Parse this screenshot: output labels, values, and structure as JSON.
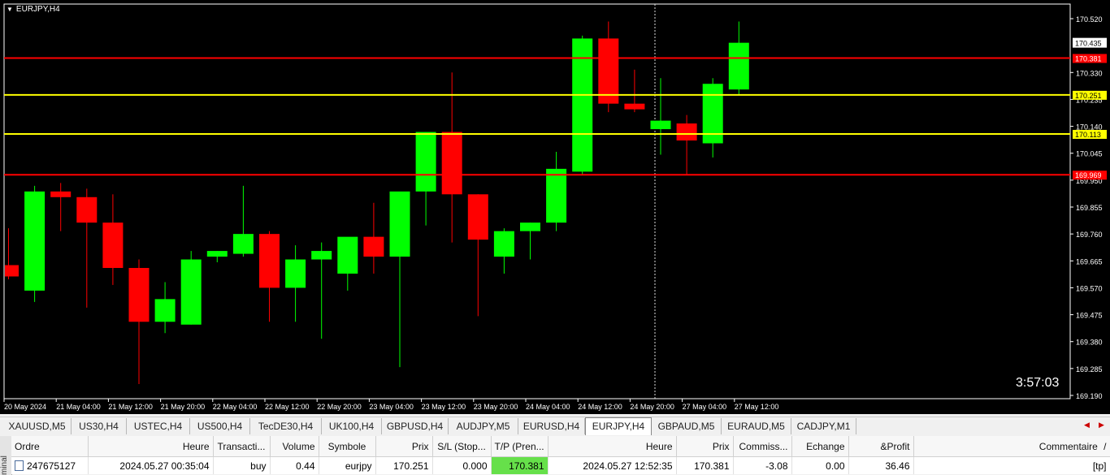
{
  "chart": {
    "symbol": "EURJPY,H4",
    "countdown": "3:57:03",
    "ylim": [
      169.19,
      170.58
    ],
    "price_ticks": [
      "170.520",
      "170.330",
      "170.235",
      "170.140",
      "170.045",
      "169.950",
      "169.855",
      "169.760",
      "169.665",
      "169.570",
      "169.475",
      "169.380",
      "169.285",
      "169.190"
    ],
    "time_labels": [
      "20 May 2024",
      "21 May 04:00",
      "21 May 12:00",
      "21 May 20:00",
      "22 May 04:00",
      "22 May 12:00",
      "22 May 20:00",
      "23 May 04:00",
      "23 May 12:00",
      "23 May 20:00",
      "24 May 04:00",
      "24 May 12:00",
      "24 May 20:00",
      "27 May 04:00",
      "27 May 12:00"
    ],
    "current_price": "170.435",
    "lines": [
      {
        "price": 170.381,
        "label": "170.381",
        "color": "#ff0000",
        "text_color": "#ffffff"
      },
      {
        "price": 170.251,
        "label": "170.251",
        "color": "#ffff00",
        "text_color": "#000000"
      },
      {
        "price": 170.113,
        "label": "170.113",
        "color": "#ffff00",
        "text_color": "#000000"
      },
      {
        "price": 169.969,
        "label": "169.969",
        "color": "#ff0000",
        "text_color": "#ffffff"
      }
    ],
    "colors": {
      "bull": "#00ff00",
      "bear": "#ff0000",
      "background": "#000000",
      "foreground": "#ffffff"
    }
  },
  "chart_data": {
    "type": "candlestick",
    "ohlc": [
      [
        169.65,
        169.78,
        169.6,
        169.61
      ],
      [
        169.56,
        169.93,
        169.52,
        169.91
      ],
      [
        169.91,
        169.94,
        169.77,
        169.89
      ],
      [
        169.89,
        169.92,
        169.5,
        169.8
      ],
      [
        169.8,
        169.9,
        169.58,
        169.64
      ],
      [
        169.64,
        169.67,
        169.23,
        169.45
      ],
      [
        169.45,
        169.59,
        169.41,
        169.53
      ],
      [
        169.44,
        169.7,
        169.44,
        169.67
      ],
      [
        169.68,
        169.7,
        169.66,
        169.7
      ],
      [
        169.69,
        169.93,
        169.68,
        169.76
      ],
      [
        169.76,
        169.77,
        169.45,
        169.57
      ],
      [
        169.57,
        169.72,
        169.45,
        169.67
      ],
      [
        169.67,
        169.73,
        169.39,
        169.7
      ],
      [
        169.62,
        169.74,
        169.56,
        169.75
      ],
      [
        169.75,
        169.87,
        169.62,
        169.68
      ],
      [
        169.68,
        169.83,
        169.29,
        169.91
      ],
      [
        169.91,
        170.12,
        169.79,
        170.12
      ],
      [
        170.12,
        170.33,
        169.73,
        169.9
      ],
      [
        169.9,
        169.9,
        169.47,
        169.74
      ],
      [
        169.68,
        169.78,
        169.62,
        169.77
      ],
      [
        169.77,
        169.8,
        169.67,
        169.8
      ],
      [
        169.8,
        170.05,
        169.77,
        169.99
      ],
      [
        169.98,
        170.46,
        169.97,
        170.45
      ],
      [
        170.45,
        170.51,
        170.19,
        170.22
      ],
      [
        170.22,
        170.34,
        170.19,
        170.2
      ],
      [
        170.13,
        170.31,
        170.04,
        170.16
      ],
      [
        170.15,
        170.18,
        169.97,
        170.09
      ],
      [
        170.08,
        170.31,
        170.03,
        170.29
      ],
      [
        170.27,
        170.51,
        170.25,
        170.435
      ]
    ]
  },
  "tabs": {
    "items": [
      "XAUUSD,M5",
      "US30,H4",
      "USTEC,H4",
      "US500,H4",
      "TecDE30,H4",
      "UK100,H4",
      "GBPUSD,H4",
      "AUDJPY,M5",
      "EURUSD,H4",
      "EURJPY,H4",
      "GBPAUD,M5",
      "EURAUD,M5",
      "CADJPY,M1"
    ],
    "active_index": 9
  },
  "terminal": {
    "side_label": "minal",
    "headers": [
      "Ordre",
      "Heure",
      "Transacti...",
      "Volume",
      "Symbole",
      "Prix",
      "S/L (Stop...",
      "T/P (Pren...",
      "Heure",
      "Prix",
      "Commiss...",
      "Echange",
      "&Profit",
      "Commentaire"
    ],
    "row": [
      "247675127",
      "2024.05.27 00:35:04",
      "buy",
      "0.44",
      "eurjpy",
      "170.251",
      "0.000",
      "170.381",
      "2024.05.27 12:52:35",
      "170.381",
      "-3.08",
      "0.00",
      "36.46",
      "[tp]"
    ],
    "sort_indicator": "/"
  }
}
